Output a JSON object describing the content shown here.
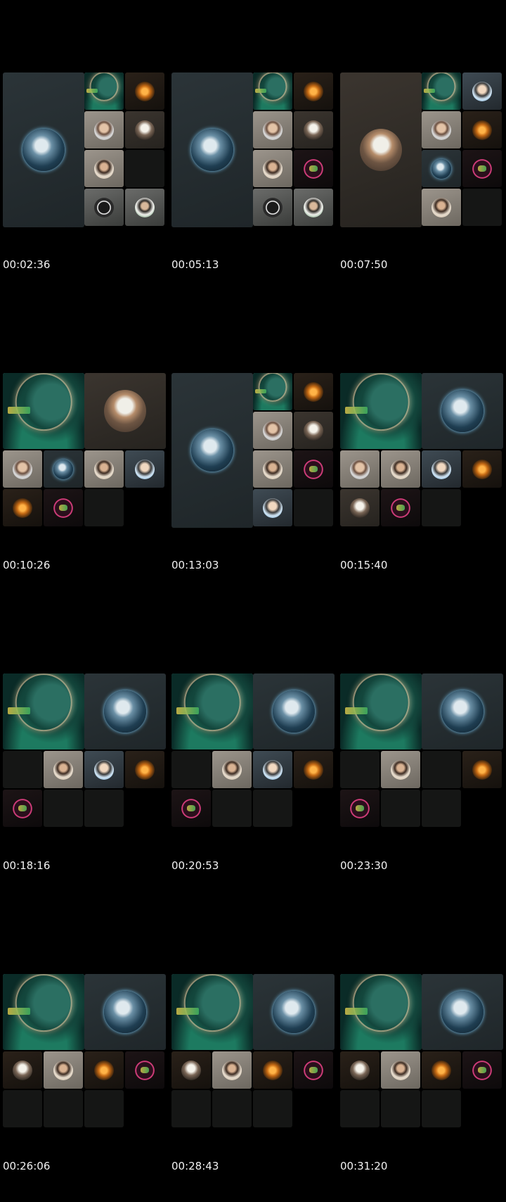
{
  "frames": [
    {
      "timestamp": "00:02:36",
      "layout": "A",
      "tiles": [
        {
          "style": "slate",
          "avatar": "ocean"
        },
        {
          "style": "green",
          "avatar": "hijab"
        },
        {
          "style": "darkbrown",
          "avatar": "orange"
        },
        {
          "style": "lightgray",
          "avatar": "face"
        },
        {
          "style": "brown",
          "avatar": "turban"
        },
        {
          "style": "lightgray",
          "avatar": "bearded"
        },
        {
          "style": "empty",
          "avatar": ""
        },
        {
          "style": "white",
          "avatar": "emblem"
        },
        {
          "style": "white",
          "avatar": "whiteshirt"
        }
      ]
    },
    {
      "timestamp": "00:05:13",
      "layout": "A",
      "tiles": [
        {
          "style": "slate",
          "avatar": "ocean"
        },
        {
          "style": "green",
          "avatar": "hijab"
        },
        {
          "style": "darkbrown",
          "avatar": "orange"
        },
        {
          "style": "lightgray",
          "avatar": "face"
        },
        {
          "style": "brown",
          "avatar": "turban"
        },
        {
          "style": "lightgray",
          "avatar": "bearded"
        },
        {
          "style": "darkred",
          "avatar": "ring"
        },
        {
          "style": "white",
          "avatar": "emblem"
        },
        {
          "style": "white",
          "avatar": "whiteshirt"
        }
      ]
    },
    {
      "timestamp": "00:07:50",
      "layout": "A",
      "tiles": [
        {
          "style": "brown",
          "avatar": "elder"
        },
        {
          "style": "green",
          "avatar": "hijab"
        },
        {
          "style": "bluegray",
          "avatar": "portrait"
        },
        {
          "style": "lightgray",
          "avatar": "face"
        },
        {
          "style": "darkbrown",
          "avatar": "orange"
        },
        {
          "style": "slate",
          "avatar": "ocean"
        },
        {
          "style": "darkred",
          "avatar": "ring"
        },
        {
          "style": "lightgray",
          "avatar": "bearded"
        },
        {
          "style": "empty",
          "avatar": ""
        }
      ]
    },
    {
      "timestamp": "00:10:26",
      "layout": "B",
      "tiles": [
        {
          "style": "green",
          "avatar": "hijab"
        },
        {
          "style": "brown",
          "avatar": "elder"
        },
        {
          "style": "lightgray",
          "avatar": "face"
        },
        {
          "style": "slate",
          "avatar": "ocean"
        },
        {
          "style": "lightgray",
          "avatar": "bearded"
        },
        {
          "style": "bluegray",
          "avatar": "portrait"
        },
        {
          "style": "darkbrown",
          "avatar": "orange"
        },
        {
          "style": "darkred",
          "avatar": "ring"
        },
        {
          "style": "empty",
          "avatar": ""
        }
      ]
    },
    {
      "timestamp": "00:13:03",
      "layout": "A",
      "tiles": [
        {
          "style": "slate",
          "avatar": "ocean"
        },
        {
          "style": "green",
          "avatar": "hijab"
        },
        {
          "style": "darkbrown",
          "avatar": "orange"
        },
        {
          "style": "lightgray",
          "avatar": "face"
        },
        {
          "style": "brown",
          "avatar": "turban"
        },
        {
          "style": "lightgray",
          "avatar": "bearded"
        },
        {
          "style": "darkred",
          "avatar": "ring"
        },
        {
          "style": "bluegray",
          "avatar": "portrait"
        },
        {
          "style": "empty",
          "avatar": ""
        }
      ]
    },
    {
      "timestamp": "00:15:40",
      "layout": "B",
      "tiles": [
        {
          "style": "green",
          "avatar": "hijab"
        },
        {
          "style": "slate",
          "avatar": "ocean"
        },
        {
          "style": "lightgray",
          "avatar": "face"
        },
        {
          "style": "lightgray",
          "avatar": "bearded"
        },
        {
          "style": "bluegray",
          "avatar": "portrait"
        },
        {
          "style": "darkbrown",
          "avatar": "orange"
        },
        {
          "style": "brown",
          "avatar": "turban"
        },
        {
          "style": "darkred",
          "avatar": "ring"
        },
        {
          "style": "empty",
          "avatar": ""
        }
      ]
    },
    {
      "timestamp": "00:18:16",
      "layout": "C",
      "tiles": [
        {
          "style": "green",
          "avatar": "hijab"
        },
        {
          "style": "slate",
          "avatar": "ocean"
        },
        {
          "style": "empty",
          "avatar": ""
        },
        {
          "style": "lightgray",
          "avatar": "bearded"
        },
        {
          "style": "bluegray",
          "avatar": "portrait"
        },
        {
          "style": "darkbrown",
          "avatar": "orange"
        },
        {
          "style": "darkred",
          "avatar": "ring"
        },
        {
          "style": "empty",
          "avatar": ""
        },
        {
          "style": "empty",
          "avatar": ""
        }
      ]
    },
    {
      "timestamp": "00:20:53",
      "layout": "C",
      "tiles": [
        {
          "style": "green",
          "avatar": "hijab"
        },
        {
          "style": "slate",
          "avatar": "ocean"
        },
        {
          "style": "empty",
          "avatar": ""
        },
        {
          "style": "lightgray",
          "avatar": "bearded"
        },
        {
          "style": "bluegray",
          "avatar": "portrait"
        },
        {
          "style": "darkbrown",
          "avatar": "orange"
        },
        {
          "style": "darkred",
          "avatar": "ring"
        },
        {
          "style": "empty",
          "avatar": ""
        },
        {
          "style": "empty",
          "avatar": ""
        }
      ]
    },
    {
      "timestamp": "00:23:30",
      "layout": "C",
      "tiles": [
        {
          "style": "green",
          "avatar": "hijab"
        },
        {
          "style": "slate",
          "avatar": "ocean"
        },
        {
          "style": "empty",
          "avatar": ""
        },
        {
          "style": "lightgray",
          "avatar": "bearded"
        },
        {
          "style": "empty",
          "avatar": ""
        },
        {
          "style": "darkbrown",
          "avatar": "orange"
        },
        {
          "style": "darkred",
          "avatar": "ring"
        },
        {
          "style": "empty",
          "avatar": ""
        },
        {
          "style": "empty",
          "avatar": ""
        }
      ]
    },
    {
      "timestamp": "00:26:06",
      "layout": "D",
      "tiles": [
        {
          "style": "green",
          "avatar": "hijab"
        },
        {
          "style": "slate",
          "avatar": "ocean"
        },
        {
          "style": "darkbrown",
          "avatar": "turban"
        },
        {
          "style": "lightgray",
          "avatar": "bearded"
        },
        {
          "style": "darkbrown",
          "avatar": "orange"
        },
        {
          "style": "darkred",
          "avatar": "ring"
        },
        {
          "style": "empty",
          "avatar": ""
        },
        {
          "style": "empty",
          "avatar": ""
        },
        {
          "style": "empty",
          "avatar": ""
        }
      ]
    },
    {
      "timestamp": "00:28:43",
      "layout": "D",
      "tiles": [
        {
          "style": "green",
          "avatar": "hijab"
        },
        {
          "style": "slate",
          "avatar": "ocean"
        },
        {
          "style": "darkbrown",
          "avatar": "turban"
        },
        {
          "style": "lightgray",
          "avatar": "bearded"
        },
        {
          "style": "darkbrown",
          "avatar": "orange"
        },
        {
          "style": "darkred",
          "avatar": "ring"
        },
        {
          "style": "empty",
          "avatar": ""
        },
        {
          "style": "empty",
          "avatar": ""
        },
        {
          "style": "empty",
          "avatar": ""
        }
      ]
    },
    {
      "timestamp": "00:31:20",
      "layout": "D",
      "tiles": [
        {
          "style": "green",
          "avatar": "hijab"
        },
        {
          "style": "slate",
          "avatar": "ocean"
        },
        {
          "style": "darkbrown",
          "avatar": "turban"
        },
        {
          "style": "lightgray",
          "avatar": "bearded"
        },
        {
          "style": "darkbrown",
          "avatar": "orange"
        },
        {
          "style": "darkred",
          "avatar": "ring"
        },
        {
          "style": "empty",
          "avatar": ""
        },
        {
          "style": "empty",
          "avatar": ""
        },
        {
          "style": "empty",
          "avatar": ""
        }
      ]
    }
  ]
}
